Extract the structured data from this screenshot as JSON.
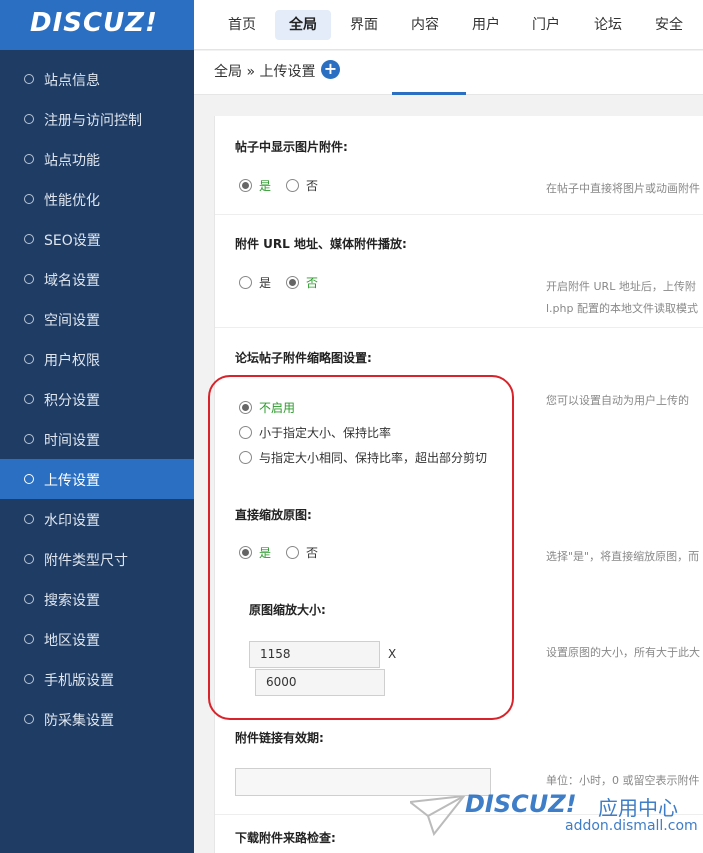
{
  "logo": "DISCUZ!",
  "nav": [
    "首页",
    "全局",
    "界面",
    "内容",
    "用户",
    "门户",
    "论坛",
    "安全"
  ],
  "nav_active": "全局",
  "breadcrumb": "全局 » 上传设置",
  "plus_icon": "+",
  "sidebar": [
    "站点信息",
    "注册与访问控制",
    "站点功能",
    "性能优化",
    "SEO设置",
    "域名设置",
    "空间设置",
    "用户权限",
    "积分设置",
    "时间设置",
    "上传设置",
    "水印设置",
    "附件类型尺寸",
    "搜索设置",
    "地区设置",
    "手机版设置",
    "防采集设置"
  ],
  "sidebar_active": "上传设置",
  "settings": {
    "show_image": {
      "title": "帖子中显示图片附件:",
      "yes": "是",
      "no": "否",
      "selected": "是",
      "hint": "在帖子中直接将图片或动画附件"
    },
    "attach_url": {
      "title": "附件 URL 地址、媒体附件播放:",
      "yes": "是",
      "no": "否",
      "selected": "否",
      "hint1": "开启附件 URL 地址后，上传附",
      "hint2": "l.php 配置的本地文件读取模式"
    },
    "thumb": {
      "title": "论坛帖子附件缩略图设置:",
      "options": [
        "不启用",
        "小于指定大小、保持比率",
        "与指定大小相同、保持比率，超出部分剪切"
      ],
      "selected": "不启用",
      "hint": "您可以设置自动为用户上传的"
    },
    "resize_original": {
      "title": "直接缩放原图:",
      "yes": "是",
      "no": "否",
      "selected": "是",
      "hint": "选择\"是\"，将直接缩放原图，而"
    },
    "original_size": {
      "title": "原图缩放大小:",
      "width": "1158",
      "x_label": "X",
      "height": "6000",
      "hint": "设置原图的大小，所有大于此大"
    },
    "link_expire": {
      "title": "附件链接有效期:",
      "value": "",
      "hint": "单位：小时，0 或留空表示附件"
    },
    "referer_check": {
      "title": "下载附件来路检查:"
    }
  },
  "watermark": {
    "logo": "DISCUZ!",
    "cn": "应用中心",
    "url": "addon.dismall.com"
  }
}
